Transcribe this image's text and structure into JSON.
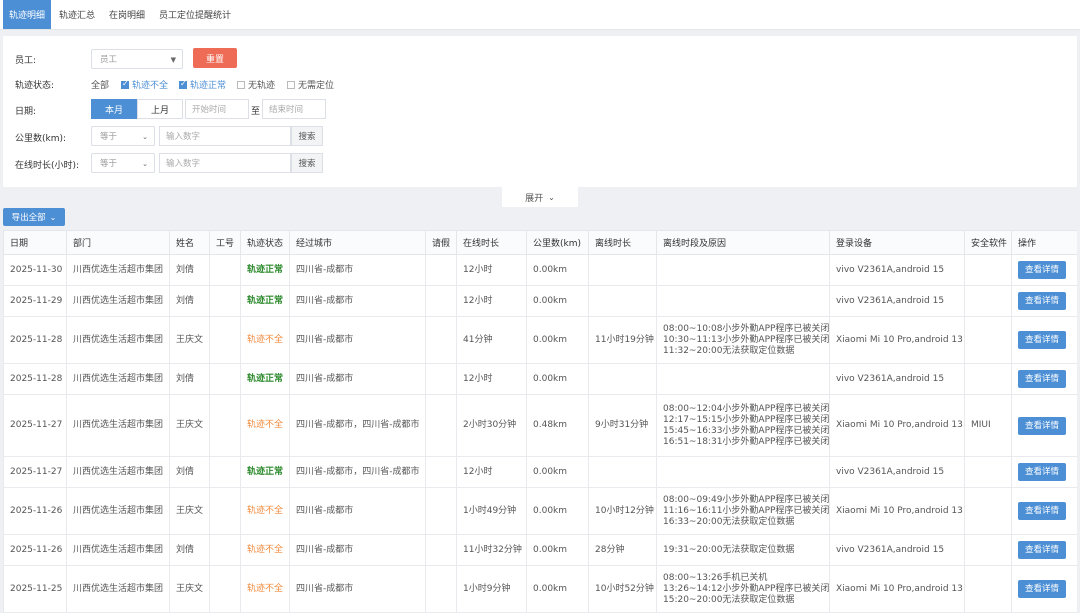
{
  "tabs": [
    "轨迹明细",
    "轨迹汇总",
    "在岗明细",
    "员工定位提醒统计"
  ],
  "filter": {
    "employee_label": "员工:",
    "employee_placeholder": "员工",
    "reset_label": "重置",
    "status_label": "轨迹状态:",
    "status_all": "全部",
    "status_options": [
      {
        "label": "轨迹不全",
        "checked": true
      },
      {
        "label": "轨迹正常",
        "checked": true
      },
      {
        "label": "无轨迹",
        "checked": false
      },
      {
        "label": "无需定位",
        "checked": false
      }
    ],
    "date_label": "日期:",
    "date_this_month": "本月",
    "date_last_month": "上月",
    "date_start_placeholder": "开始时间",
    "date_to": "至",
    "date_end_placeholder": "结束时间",
    "km_label": "公里数(km):",
    "km_operator": "等于",
    "km_placeholder": "输入数字",
    "km_search": "搜索",
    "online_label": "在线时长(小时):",
    "online_operator": "等于",
    "online_placeholder": "输入数字",
    "online_search": "搜索"
  },
  "expand_label": "展开",
  "export_label": "导出全部",
  "table": {
    "columns": [
      "日期",
      "部门",
      "姓名",
      "工号",
      "轨迹状态",
      "经过城市",
      "请假",
      "在线时长",
      "公里数(km)",
      "离线时长",
      "离线时段及原因",
      "登录设备",
      "安全软件",
      "操作"
    ],
    "action_label": "查看详情",
    "rows": [
      {
        "date": "2025-11-30",
        "dept": "川西优选生活超市集团",
        "name": "刘倩",
        "id": "",
        "status": "轨迹正常",
        "ok": true,
        "city": "四川省-成都市",
        "leave": "",
        "online": "12小时",
        "km": "0.00km",
        "offline": "",
        "reasons": [],
        "device": "vivo V2361A,android 15",
        "security": ""
      },
      {
        "date": "2025-11-29",
        "dept": "川西优选生活超市集团",
        "name": "刘倩",
        "id": "",
        "status": "轨迹正常",
        "ok": true,
        "city": "四川省-成都市",
        "leave": "",
        "online": "12小时",
        "km": "0.00km",
        "offline": "",
        "reasons": [],
        "device": "vivo V2361A,android 15",
        "security": ""
      },
      {
        "date": "2025-11-28",
        "dept": "川西优选生活超市集团",
        "name": "王庆文",
        "id": "",
        "status": "轨迹不全",
        "ok": false,
        "city": "四川省-成都市",
        "leave": "",
        "online": "41分钟",
        "km": "0.00km",
        "offline": "11小时19分钟",
        "reasons": [
          "08:00~10:08小步外勤APP程序已被关闭",
          "10:30~11:13小步外勤APP程序已被关闭",
          "11:32~20:00无法获取定位数据"
        ],
        "device": "Xiaomi Mi 10 Pro,android 13",
        "security": ""
      },
      {
        "date": "2025-11-28",
        "dept": "川西优选生活超市集团",
        "name": "刘倩",
        "id": "",
        "status": "轨迹正常",
        "ok": true,
        "city": "四川省-成都市",
        "leave": "",
        "online": "12小时",
        "km": "0.00km",
        "offline": "",
        "reasons": [],
        "device": "vivo V2361A,android 15",
        "security": ""
      },
      {
        "date": "2025-11-27",
        "dept": "川西优选生活超市集团",
        "name": "王庆文",
        "id": "",
        "status": "轨迹不全",
        "ok": false,
        "city": "四川省-成都市，四川省-成都市",
        "leave": "",
        "online": "2小时30分钟",
        "km": "0.48km",
        "offline": "9小时31分钟",
        "reasons": [
          "08:00~12:04小步外勤APP程序已被关闭",
          "12:17~15:15小步外勤APP程序已被关闭",
          "15:45~16:33小步外勤APP程序已被关闭",
          "16:51~18:31小步外勤APP程序已被关闭"
        ],
        "device": "Xiaomi Mi 10 Pro,android 13",
        "security": "MIUI"
      },
      {
        "date": "2025-11-27",
        "dept": "川西优选生活超市集团",
        "name": "刘倩",
        "id": "",
        "status": "轨迹正常",
        "ok": true,
        "city": "四川省-成都市，四川省-成都市",
        "leave": "",
        "online": "12小时",
        "km": "0.00km",
        "offline": "",
        "reasons": [],
        "device": "vivo V2361A,android 15",
        "security": ""
      },
      {
        "date": "2025-11-26",
        "dept": "川西优选生活超市集团",
        "name": "王庆文",
        "id": "",
        "status": "轨迹不全",
        "ok": false,
        "city": "四川省-成都市",
        "leave": "",
        "online": "1小时49分钟",
        "km": "0.00km",
        "offline": "10小时12分钟",
        "reasons": [
          "08:00~09:49小步外勤APP程序已被关闭",
          "11:16~16:11小步外勤APP程序已被关闭",
          "16:33~20:00无法获取定位数据"
        ],
        "device": "Xiaomi Mi 10 Pro,android 13",
        "security": ""
      },
      {
        "date": "2025-11-26",
        "dept": "川西优选生活超市集团",
        "name": "刘倩",
        "id": "",
        "status": "轨迹不全",
        "ok": false,
        "city": "四川省-成都市",
        "leave": "",
        "online": "11小时32分钟",
        "km": "0.00km",
        "offline": "28分钟",
        "reasons": [
          "19:31~20:00无法获取定位数据"
        ],
        "device": "vivo V2361A,android 15",
        "security": ""
      },
      {
        "date": "2025-11-25",
        "dept": "川西优选生活超市集团",
        "name": "王庆文",
        "id": "",
        "status": "轨迹不全",
        "ok": false,
        "city": "四川省-成都市",
        "leave": "",
        "online": "1小时9分钟",
        "km": "0.00km",
        "offline": "10小时52分钟",
        "reasons": [
          "08:00~13:26手机已关机",
          "13:26~14:12小步外勤APP程序已被关闭",
          "15:20~20:00无法获取定位数据"
        ],
        "device": "Xiaomi Mi 10 Pro,android 13",
        "security": ""
      }
    ]
  }
}
